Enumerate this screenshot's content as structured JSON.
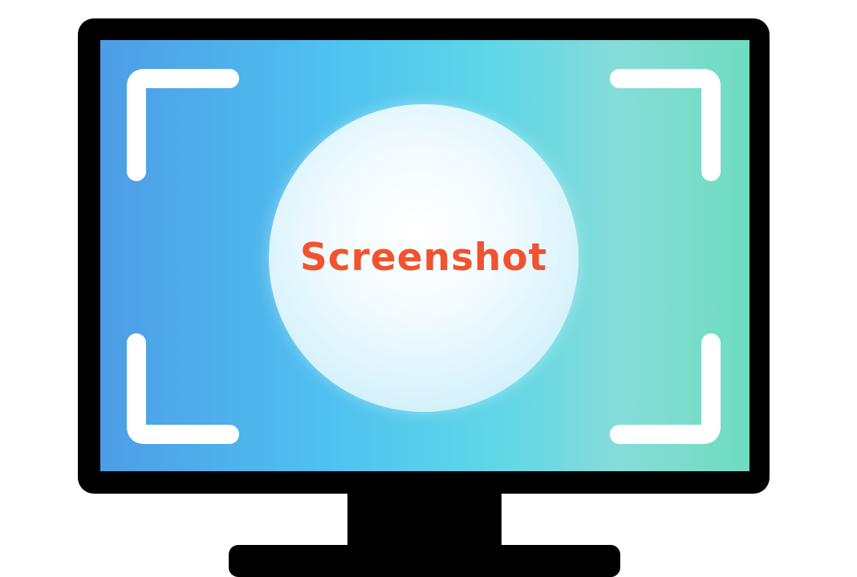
{
  "graphic": {
    "label": "Screenshot",
    "icon": "monitor-with-capture-brackets",
    "colors": {
      "frame": "#000000",
      "screen_gradient": [
        "#4d9de6",
        "#4fc1f0",
        "#5ed6e8",
        "#86dcd8",
        "#6fdcc0"
      ],
      "brackets": "#ffffff",
      "lens": "#eaf8fd",
      "label": "#f2522e"
    }
  }
}
